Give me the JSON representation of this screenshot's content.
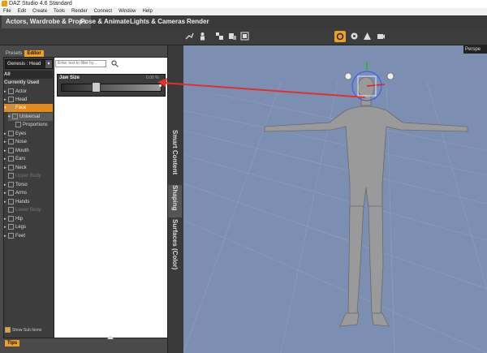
{
  "window": {
    "title": "DAZ Studio 4.6 Standard"
  },
  "menu": [
    "File",
    "Edit",
    "Create",
    "Tools",
    "Render",
    "Connect",
    "Window",
    "Help"
  ],
  "main_tabs": [
    {
      "label": "Actors, Wardrobe & Props"
    },
    {
      "label": "Pose & Animate"
    },
    {
      "label": "Lights & Cameras"
    },
    {
      "label": "Render"
    }
  ],
  "toolbar_icons": [
    "move-tool-icon",
    "pose-tool-icon",
    "scale-tool-icon",
    "node-tool-icon",
    "geometry-tool-icon",
    "active-pose-icon",
    "render-icon",
    "scene-icon",
    "camera-icon"
  ],
  "pane_tabs": {
    "presets": "Presets",
    "editor": "Editor"
  },
  "node_select": {
    "value": "Genesis : Head",
    "arrow": "▾"
  },
  "tree": {
    "all": "All",
    "currently_used": "Currently Used",
    "items": [
      {
        "label": "Actor"
      },
      {
        "label": "Head"
      },
      {
        "label": "Face"
      },
      {
        "label": "Universal"
      },
      {
        "label": "Proportions"
      },
      {
        "label": "Eyes"
      },
      {
        "label": "Nose"
      },
      {
        "label": "Mouth"
      },
      {
        "label": "Ears"
      },
      {
        "label": "Neck"
      },
      {
        "label": "Upper Body"
      },
      {
        "label": "Torso"
      },
      {
        "label": "Arms"
      },
      {
        "label": "Hands"
      },
      {
        "label": "Lower Body"
      },
      {
        "label": "Hip"
      },
      {
        "label": "Legs"
      },
      {
        "label": "Feet"
      }
    ]
  },
  "show_sub_items": "Show Sub Items",
  "tips_button": "Tips",
  "filter": {
    "placeholder": "Enter text to filter by..."
  },
  "slider": {
    "label": "Jaw Size",
    "value": "0.00 %",
    "level": 0.5
  },
  "side_tabs": {
    "smart_content": "Smart Content",
    "shaping": "Shaping",
    "surfaces": "Surfaces (Color)"
  },
  "viewport": {
    "camera": "Perspe"
  },
  "colors": {
    "accent": "#f0a020",
    "selection": "#e28a1a",
    "viewport_bg": "#7c8fb2",
    "annotation": "#e03030"
  }
}
